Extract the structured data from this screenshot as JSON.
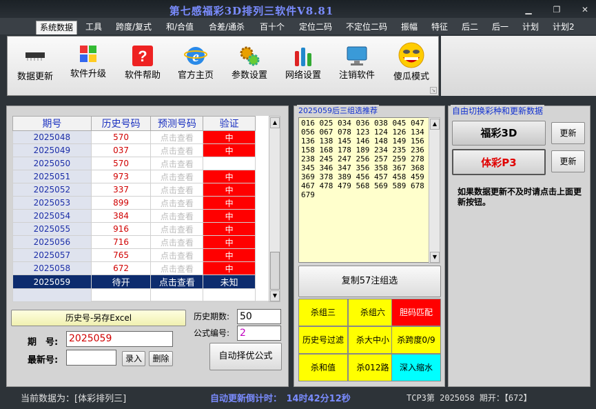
{
  "window": {
    "title": "第七感福彩3D排列三软件V8.81"
  },
  "menu": [
    {
      "label": "系统数据",
      "active": true
    },
    {
      "label": "工具"
    },
    {
      "label": "跨度/复式"
    },
    {
      "label": "和/合值"
    },
    {
      "label": "合差/通杀"
    },
    {
      "label": "百十个"
    },
    {
      "label": "定位二码"
    },
    {
      "label": "不定位二码"
    },
    {
      "label": "振幅"
    },
    {
      "label": "特征"
    },
    {
      "label": "后二"
    },
    {
      "label": "后一"
    },
    {
      "label": "计划"
    },
    {
      "label": "计划2"
    }
  ],
  "ribbon": [
    {
      "label": "数据更新",
      "icon": "chip-icon"
    },
    {
      "label": "软件升级",
      "icon": "windows-icon"
    },
    {
      "label": "软件帮助",
      "icon": "help-icon"
    },
    {
      "label": "官方主页",
      "icon": "ie-icon"
    },
    {
      "label": "参数设置",
      "icon": "gears-icon"
    },
    {
      "label": "网络设置",
      "icon": "bars-icon"
    },
    {
      "label": "注销软件",
      "icon": "monitor-icon"
    },
    {
      "label": "傻瓜模式",
      "icon": "smiley-icon"
    }
  ],
  "grid": {
    "headers": [
      "期号",
      "历史号码",
      "预测号码",
      "验证"
    ],
    "rows": [
      {
        "id": "2025048",
        "his": "570",
        "pred": "点击查看",
        "ver": "中"
      },
      {
        "id": "2025049",
        "his": "037",
        "pred": "点击查看",
        "ver": "中"
      },
      {
        "id": "2025050",
        "his": "570",
        "pred": "点击查看",
        "ver": ""
      },
      {
        "id": "2025051",
        "his": "973",
        "pred": "点击查看",
        "ver": "中"
      },
      {
        "id": "2025052",
        "his": "337",
        "pred": "点击查看",
        "ver": "中"
      },
      {
        "id": "2025053",
        "his": "899",
        "pred": "点击查看",
        "ver": "中"
      },
      {
        "id": "2025054",
        "his": "384",
        "pred": "点击查看",
        "ver": "中"
      },
      {
        "id": "2025055",
        "his": "916",
        "pred": "点击查看",
        "ver": "中"
      },
      {
        "id": "2025056",
        "his": "716",
        "pred": "点击查看",
        "ver": "中"
      },
      {
        "id": "2025057",
        "his": "765",
        "pred": "点击查看",
        "ver": "中"
      },
      {
        "id": "2025058",
        "his": "672",
        "pred": "点击查看",
        "ver": "中"
      }
    ],
    "last": {
      "id": "2025059",
      "his": "待开",
      "pred": "点击查看",
      "ver": "未知"
    }
  },
  "left": {
    "export_btn": "历史号-另存Excel",
    "period_label": "期　号:",
    "period_value": "2025059",
    "latest_label": "最新号:",
    "latest_value": "",
    "enter_btn": "录入",
    "delete_btn": "删除",
    "hist_count_label": "历史期数:",
    "hist_count_value": "50",
    "formula_label": "公式编号:",
    "formula_value": "2",
    "auto_btn": "自动择优公式"
  },
  "mid": {
    "group_title": "2025059后三组选推荐",
    "numbers": "016 025 034 036 038 045 047 056 067 078 123 124 126 134 136 138 145 146 148 149 156 158 168 178 189 234 235 236 238 245 247 256 257 259 278 345 346 347 356 358 367 368 369 378 389 456 457 458 459 467 478 479 568 569 589 678 679",
    "copy_btn": "复制57注组选",
    "cells": [
      {
        "label": "杀组三",
        "color": "yellow"
      },
      {
        "label": "杀组六",
        "color": "yellow"
      },
      {
        "label": "胆码匹配",
        "color": "red"
      },
      {
        "label": "历史号过滤",
        "color": "yellow"
      },
      {
        "label": "杀大中小",
        "color": "yellow"
      },
      {
        "label": "杀跨度0/9",
        "color": "yellow"
      },
      {
        "label": "杀和值",
        "color": "yellow"
      },
      {
        "label": "杀012路",
        "color": "yellow"
      },
      {
        "label": "深入缩水",
        "color": "cyan"
      }
    ]
  },
  "right": {
    "group_title": "自由切换彩种和更新数据",
    "lottery1": "福彩3D",
    "lottery2": "体彩P3",
    "update1": "更新",
    "update2": "更新",
    "note": "如果数据更新不及时请点击上面更新按钮。"
  },
  "status": {
    "current": "当前数据为：[体彩排列三]",
    "countdown": "自动更新倒计时：　14时42分12秒",
    "draw": "TCP3第 2025058 期开：【672】"
  },
  "colors": {
    "accent": "#1a30c0",
    "hit": "#ff0000",
    "last_row": "#0d2c6e"
  }
}
